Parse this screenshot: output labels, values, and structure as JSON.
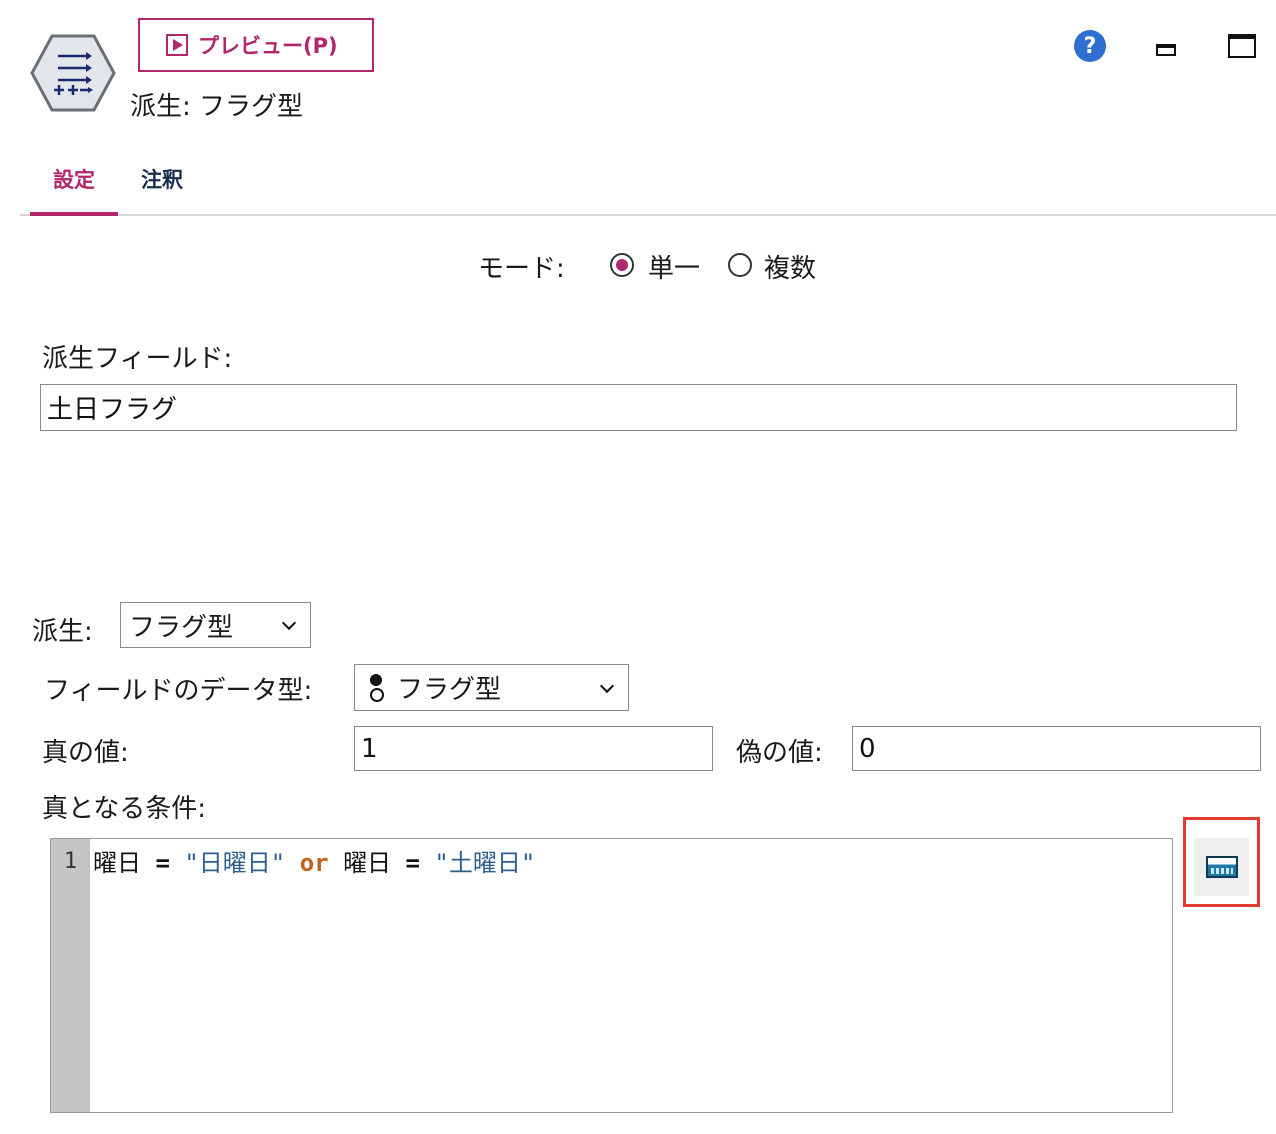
{
  "header": {
    "preview_label": "プレビュー(P)",
    "node_title": "派生: フラグ型",
    "help_glyph": "?"
  },
  "tabs": [
    {
      "label": "設定",
      "active": true
    },
    {
      "label": "注釈",
      "active": false
    }
  ],
  "mode": {
    "label": "モード:",
    "options": [
      {
        "label": "単一",
        "selected": true
      },
      {
        "label": "複数",
        "selected": false
      }
    ]
  },
  "derived_field": {
    "label": "派生フィールド:",
    "value": "土日フラグ"
  },
  "derive_as": {
    "label": "派生:",
    "selected": "フラグ型"
  },
  "field_data_type": {
    "label": "フィールドのデータ型:",
    "selected": "フラグ型",
    "icon": "flag-type-icon"
  },
  "true_value": {
    "label": "真の値:",
    "value": "1"
  },
  "false_value": {
    "label": "偽の値:",
    "value": "0"
  },
  "condition": {
    "label": "真となる条件:",
    "line_number": "1",
    "tokens": {
      "t1": "曜日",
      "t2": " = ",
      "t3": "\"日曜日\"",
      "t4": " or ",
      "t5": "曜日",
      "t6": " = ",
      "t7": "\"土曜日\""
    }
  },
  "colors": {
    "accent": "#b1276b",
    "tab_inactive": "#1a2c4e",
    "help_blue": "#2e6fd1",
    "string_token": "#2c5f8f",
    "keyword_token": "#c0611c",
    "highlight_box": "#e03a2e"
  },
  "icons": [
    "derive-node-icon",
    "play-icon",
    "help-icon",
    "minimize-icon",
    "maximize-icon",
    "chevron-down-icon",
    "flag-type-icon",
    "calculator-icon"
  ]
}
